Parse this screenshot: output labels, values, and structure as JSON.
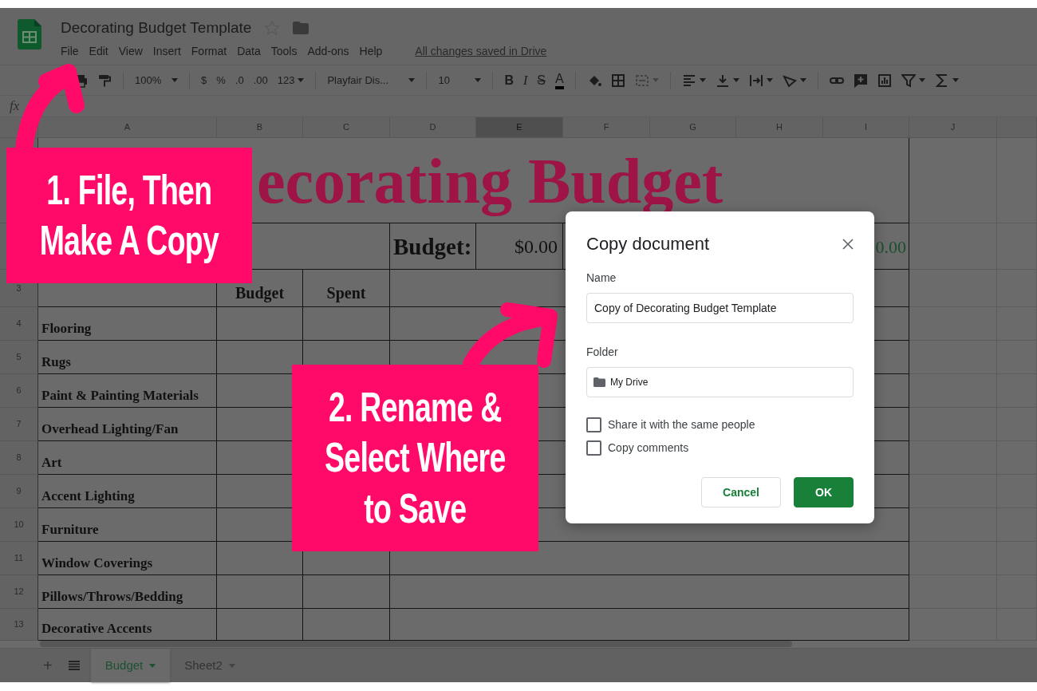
{
  "window": {
    "title": "Decorating Budget Template",
    "starred": false
  },
  "menu": [
    {
      "label": "File"
    },
    {
      "label": "Edit"
    },
    {
      "label": "View"
    },
    {
      "label": "Insert"
    },
    {
      "label": "Format"
    },
    {
      "label": "Data"
    },
    {
      "label": "Tools"
    },
    {
      "label": "Add-ons"
    },
    {
      "label": "Help"
    }
  ],
  "save_status": "All changes saved in Drive",
  "toolbar": {
    "zoom": "100%",
    "currency": "$",
    "percent": "%",
    "decrease_decimals": ".0",
    "increase_decimals": ".00",
    "more_formats": "123",
    "font": "Playfair Dis...",
    "font_size": "10",
    "bold": "B",
    "italic": "I",
    "strikethrough": "S",
    "text_color": "A",
    "merge_disabled": true
  },
  "formula_bar": {
    "label": "fx"
  },
  "columns": [
    {
      "label": "A",
      "selected": false
    },
    {
      "label": "B",
      "selected": false
    },
    {
      "label": "C",
      "selected": false
    },
    {
      "label": "D",
      "selected": false
    },
    {
      "label": "E",
      "selected": true
    },
    {
      "label": "F",
      "selected": false
    },
    {
      "label": "G",
      "selected": false
    },
    {
      "label": "H",
      "selected": false
    },
    {
      "label": "I",
      "selected": false
    },
    {
      "label": "J",
      "selected": false
    }
  ],
  "rows": [
    {
      "kind": "title",
      "title": "ecorating Budget"
    },
    {
      "kind": "budget",
      "label": "Budget:",
      "amount": "$0.00",
      "total": "0.00"
    },
    {
      "kind": "headers",
      "number": "3",
      "headers": [
        "Budget",
        "Spent"
      ]
    },
    {
      "kind": "category",
      "number": "4",
      "category": "Flooring"
    },
    {
      "kind": "category",
      "number": "5",
      "category": "Rugs"
    },
    {
      "kind": "category",
      "number": "6",
      "category": "Paint & Painting Materials"
    },
    {
      "kind": "category",
      "number": "7",
      "category": "Overhead Lighting/Fan"
    },
    {
      "kind": "category",
      "number": "8",
      "category": "Art"
    },
    {
      "kind": "category",
      "number": "9",
      "category": "Accent Lighting"
    },
    {
      "kind": "category",
      "number": "10",
      "category": "Furniture"
    },
    {
      "kind": "category",
      "number": "11",
      "category": "Window Coverings"
    },
    {
      "kind": "category",
      "number": "12",
      "category": "Pillows/Throws/Bedding"
    },
    {
      "kind": "category",
      "number": "13",
      "category": "Decorative Accents"
    }
  ],
  "add_sheet": "+",
  "sheet_tabs": [
    {
      "label": "Budget",
      "selected": true
    },
    {
      "label": "Sheet2",
      "selected": false
    }
  ],
  "dialog": {
    "title": "Copy document",
    "name_label": "Name",
    "name_value": "Copy of Decorating Budget Template",
    "folder_label": "Folder",
    "folder_value": "My Drive",
    "options": [
      {
        "label": "Share it with the same people",
        "checked": false
      },
      {
        "label": "Copy comments",
        "checked": false
      }
    ],
    "buttons": [
      {
        "label": "Cancel",
        "kind": "secondary"
      },
      {
        "label": "OK",
        "kind": "primary"
      }
    ]
  },
  "annotations": [
    {
      "text": "1. File, Then\nMake A Copy"
    },
    {
      "text": "2. Rename &\nSelect Where\nto Save"
    }
  ]
}
